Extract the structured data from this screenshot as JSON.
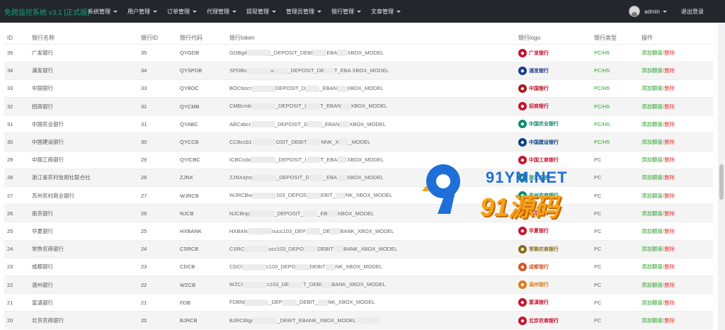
{
  "app": {
    "brand": "免跨监控系统 v3.1 [正式版]"
  },
  "nav": {
    "items": [
      "系统管理",
      "用户管理",
      "订单管理",
      "代理管理",
      "提现管理",
      "管理员管理",
      "银行管理",
      "文章管理"
    ],
    "user": "admin",
    "logout": "退出登录"
  },
  "table": {
    "headers": [
      "ID",
      "银行名称",
      "银行ID",
      "银行代码",
      "银行token",
      "银行logo",
      "银行类型",
      "操作"
    ],
    "rows": [
      {
        "id": "35",
        "name": "广发银行",
        "bid": "35",
        "code": "QYGDB",
        "token_a": "GDBgd",
        "token_b": "_DEPOSIT_DEBI",
        "token_c": "EBA",
        "token_d": "XBOX_MODEL",
        "logo": "广发银行",
        "logo_color": "#c8102e",
        "type": "PC/H5"
      },
      {
        "id": "34",
        "name": "浦发银行",
        "bid": "34",
        "code": "QYSPDB",
        "token_a": "SPDBs",
        "token_b": "u",
        "token_c": "_DEPOSIT_DE",
        "token_d": "T_EBA    XBOX_MODEL",
        "logo": "浦发银行",
        "logo_color": "#1b3a8a",
        "type": "PC/H5"
      },
      {
        "id": "33",
        "name": "中国银行",
        "bid": "33",
        "code": "QYBOC",
        "token_a": "BOCbocr",
        "token_b": "DEPOSIT_D",
        "token_c": "_EBAN",
        "token_d": "XBOX_MODEL",
        "logo": "中国银行",
        "logo_color": "#b5121b",
        "type": "PC/H5"
      },
      {
        "id": "32",
        "name": "招商银行",
        "bid": "32",
        "code": "QYCMB",
        "token_a": "CMBcmb",
        "token_b": "_DEPOSIT_I",
        "token_c": "T_EBAN",
        "token_d": "XBOX_MODEL",
        "logo": "招商银行",
        "logo_color": "#c8102e",
        "type": "PC/H5"
      },
      {
        "id": "31",
        "name": "中国农业银行",
        "bid": "31",
        "code": "QYABC",
        "token_a": "ABCabcr",
        "token_b": "_DEPOSIT_D",
        "token_c": "_EBAN",
        "token_d": "XBOX_MODEL",
        "logo": "中国农业银行",
        "logo_color": "#0d8c6d",
        "type": "PC/H5"
      },
      {
        "id": "30",
        "name": "中国建设银行",
        "bid": "30",
        "code": "QYCCB",
        "token_a": "CCBccb1",
        "token_b": "OSIT_DEBIT",
        "token_c": "NNK_X",
        "token_d": "_MODEL",
        "logo": "中国建设银行",
        "logo_color": "#0a3f8a",
        "type": "PC/H5"
      },
      {
        "id": "29",
        "name": "中国工商银行",
        "bid": "29",
        "code": "QYICBC",
        "token_a": "ICBCicbc",
        "token_b": "_DEPOSIT_I",
        "token_c": "T_EBA",
        "token_d": "XBOX_MODEL",
        "logo": "中国工商银行",
        "logo_color": "#c8102e",
        "type": "PC"
      },
      {
        "id": "28",
        "name": "浙江省农村信用社联合社",
        "bid": "28",
        "code": "ZJNX",
        "token_a": "ZJNXzjnx",
        "token_b": "_DEPOSIT_D",
        "token_c": "_EBA",
        "token_d": "XBOX_MODEL",
        "logo": "浙江农信",
        "logo_color": "#0d8c6d",
        "type": "PC"
      },
      {
        "id": "27",
        "name": "苏州农村商业银行",
        "bid": "27",
        "code": "WJRCB",
        "token_a": "WJRCBw",
        "token_b": "103_DEPOS",
        "token_c": "EBIT_",
        "token_d": "NK_XBOX_MODEL",
        "logo": "苏州农商银行",
        "logo_color": "#0d8c6d",
        "type": "PC"
      },
      {
        "id": "26",
        "name": "南京银行",
        "bid": "26",
        "code": "NJCB",
        "token_a": "NJCBnjc",
        "token_b": "_DEPOSIT_",
        "token_c": "_EB",
        "token_d": "XBOX_MODEL",
        "logo": "南京银行",
        "logo_color": "#c8102e",
        "type": "PC"
      },
      {
        "id": "25",
        "name": "华夏银行",
        "bid": "25",
        "code": "HXBANK",
        "token_a": "HXBAN",
        "token_b": "nucc103_DEP",
        "token_c": "_DE",
        "token_d": "BANK_XBOX_MODEL",
        "logo": "华夏银行",
        "logo_color": "#c8102e",
        "type": "PC"
      },
      {
        "id": "24",
        "name": "常熟农商银行",
        "bid": "24",
        "code": "CSRCB",
        "token_a": "CSRC",
        "token_b": "ucc103_DEPO",
        "token_c": "DEBIT",
        "token_d": "BANK_XBOX_MODEL",
        "logo": "常熟农商银行",
        "logo_color": "#8a6d1b",
        "type": "PC"
      },
      {
        "id": "23",
        "name": "成都银行",
        "bid": "23",
        "code": "CDCB",
        "token_a": "CDCl",
        "token_b": "c103_DEPO",
        "token_c": "DEBIT",
        "token_d": "NK_XBOX_MODEL",
        "logo": "成都银行",
        "logo_color": "#d4551f",
        "type": "PC"
      },
      {
        "id": "22",
        "name": "温州银行",
        "bid": "22",
        "code": "WZCB",
        "token_a": "WZCI",
        "token_b": "c103_DE",
        "token_c": "T_DEBI",
        "token_d": "BANK_XBOX_MODEL",
        "logo": "温州银行",
        "logo_color": "#e07b1b",
        "type": "PC"
      },
      {
        "id": "21",
        "name": "富滇银行",
        "bid": "21",
        "code": "FDB",
        "token_a": "FDBfd",
        "token_b": "_DEP",
        "token_c": "_DEBIT_",
        "token_d": "NK_XBOX_MODEL",
        "logo": "富滇银行",
        "logo_color": "#c8102e",
        "type": "PC"
      },
      {
        "id": "20",
        "name": "北京农商银行",
        "bid": "20",
        "code": "BJRCB",
        "token_a": "BJRCBtgr",
        "token_b": "_DEBIT_EBANK_XBOX_MODEL",
        "token_c": "",
        "token_d": "",
        "logo": "北京农商银行",
        "logo_color": "#c8102e",
        "type": "PC"
      }
    ],
    "op_add": "添加额度",
    "op_sep": "/",
    "op_del": "删除"
  },
  "watermark": {
    "url": "91YM.NET",
    "cn": "91源码"
  },
  "colors": {
    "nav_bg": "#23262d",
    "brand": "#19a37a",
    "ph_type": "#2aa32a",
    "delete": "#e03b3b"
  }
}
